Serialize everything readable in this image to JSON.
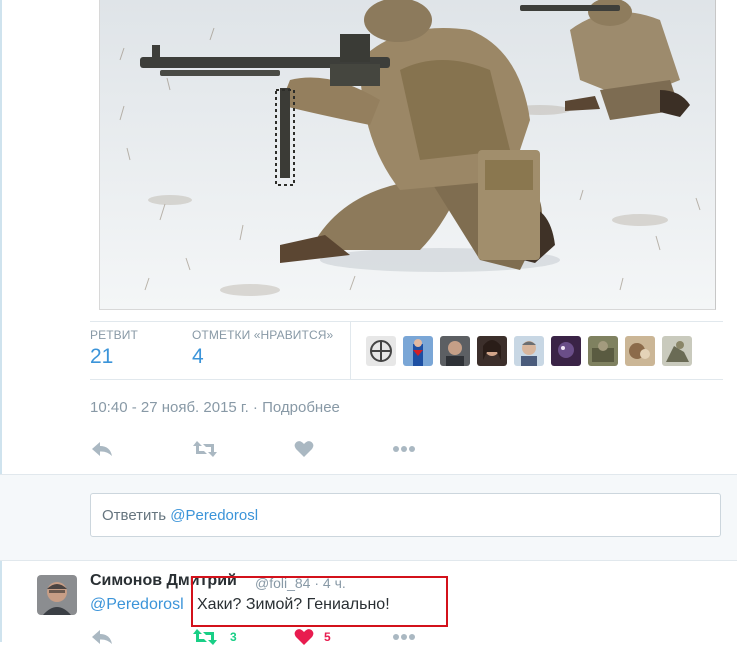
{
  "tweet": {
    "stats": {
      "retweets_label": "РЕТВИТ",
      "retweets_value": "21",
      "likes_label": "ОТМЕТКИ «НРАВИТСЯ»",
      "likes_value": "4"
    },
    "timestamp": "10:40 - 27 нояб. 2015 г.",
    "separator": "·",
    "details_link": "Подробнее",
    "actions": [
      "reply-icon",
      "retweet-icon",
      "like-icon",
      "more-icon"
    ]
  },
  "reply": {
    "prefix": "Ответить",
    "mention": "@Peredorosl"
  },
  "comment": {
    "name": "Симонов Дмитрий",
    "handle": "@foli_84",
    "time": "· 4 ч.",
    "mention": "@Peredorosl",
    "text": "Хаки? Зимой? Гениально!",
    "retweet_count": "3",
    "like_count": "5"
  },
  "colors": {
    "link": "#3b94d9",
    "muted": "#8899a6",
    "retweet_green": "#19cf86",
    "like_red": "#e81c4f",
    "highlight_border": "#d3111b"
  }
}
